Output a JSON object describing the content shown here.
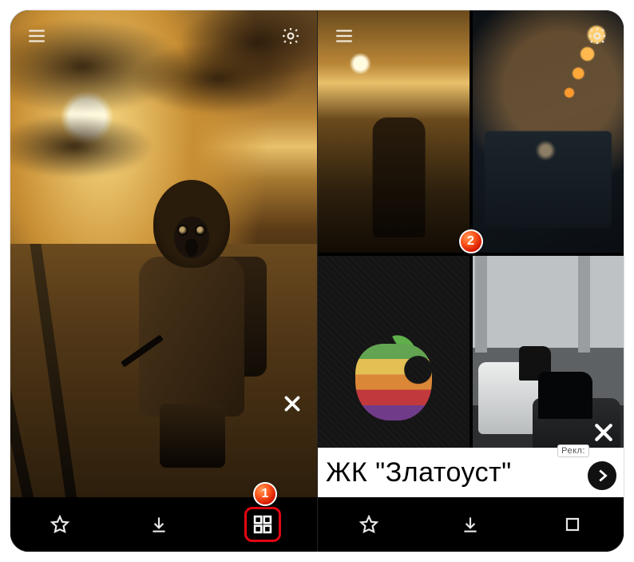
{
  "callouts": {
    "one": "1",
    "two": "2"
  },
  "icons": {
    "menu": "menu-icon",
    "settings": "gear-icon",
    "close": "close-icon",
    "star": "star-icon",
    "download": "download-icon",
    "grid": "grid-icon",
    "stop": "stop-icon",
    "chevron": "chevron-right-icon"
  },
  "ad": {
    "text": "ЖК \"Златоуст\"",
    "tag": "Рекл:"
  },
  "grid_tiles": [
    {
      "name": "wallpaper-stalker"
    },
    {
      "name": "wallpaper-tunnel-bokeh"
    },
    {
      "name": "wallpaper-apple-rainbow"
    },
    {
      "name": "wallpaper-muscle-cars"
    }
  ]
}
